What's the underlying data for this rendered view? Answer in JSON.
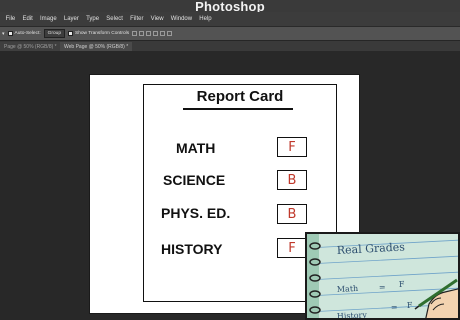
{
  "app": {
    "title": "Photoshop"
  },
  "menu": {
    "items": [
      "File",
      "Edit",
      "Image",
      "Layer",
      "Type",
      "Select",
      "Filter",
      "View",
      "Window",
      "Help"
    ]
  },
  "options": {
    "auto_select_label": "Auto-Select:",
    "auto_select_value": "Group",
    "show_transform_label": "Show Transform Controls"
  },
  "tabs": [
    {
      "label": "Page @ 50% (RGB/8) *"
    },
    {
      "label": "Web Page @ 50% (RGB/8) *"
    }
  ],
  "report_card": {
    "title": "Report Card",
    "rows": [
      {
        "subject": "MATH",
        "grade": "F"
      },
      {
        "subject": "SCIENCE",
        "grade": "B"
      },
      {
        "subject": "PHYS. ED.",
        "grade": "B"
      },
      {
        "subject": "HISTORY",
        "grade": "F"
      }
    ]
  },
  "inset": {
    "title": "Real Grades",
    "lines": [
      {
        "subject": "Math",
        "eq": "=",
        "grade": "F"
      },
      {
        "subject": "History",
        "eq": "=",
        "grade": "F"
      }
    ]
  },
  "colors": {
    "grade_ink": "#c0392b",
    "inset_paper": "#ddefe6",
    "inset_lines": "#6fa3c9"
  }
}
